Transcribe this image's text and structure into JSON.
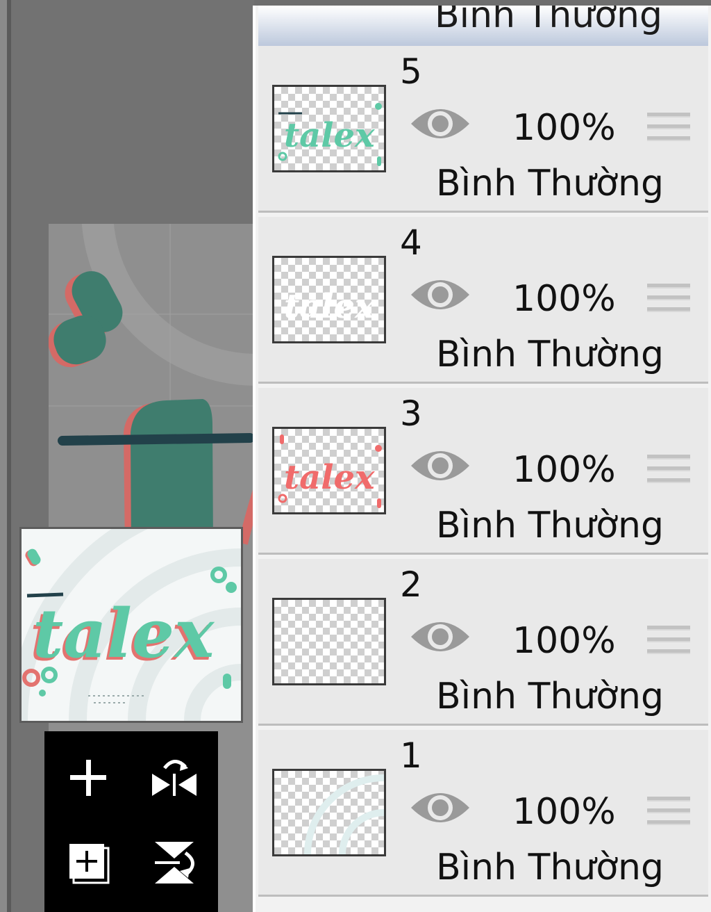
{
  "panel_top": {
    "blend_partial": "Bình Thường"
  },
  "layers": [
    {
      "number": "5",
      "opacity": "100%",
      "blend": "Bình Thường",
      "thumb_text": "talex",
      "thumb_color": "#5ec9a6"
    },
    {
      "number": "4",
      "opacity": "100%",
      "blend": "Bình Thường",
      "thumb_text": "talex",
      "thumb_color": "#ffffff"
    },
    {
      "number": "3",
      "opacity": "100%",
      "blend": "Bình Thường",
      "thumb_text": "talex",
      "thumb_color": "#f06b6b"
    },
    {
      "number": "2",
      "opacity": "100%",
      "blend": "Bình Thường",
      "thumb_text": "",
      "thumb_color": ""
    },
    {
      "number": "1",
      "opacity": "100%",
      "blend": "Bình Thường",
      "thumb_text": "",
      "thumb_color": ""
    }
  ],
  "preview": {
    "title": "talex",
    "accent": "#5ec9a6",
    "shadow": "#e3736f"
  },
  "tools": {
    "add_layer_icon": "plus-icon",
    "flip_horizontal_icon": "flip-horizontal-icon",
    "add_copy_icon": "add-copy-icon",
    "flip_vertical_icon": "flip-vertical-icon"
  },
  "colors": {
    "panel_bg": "#e9e9e9",
    "eye": "#9a9a9a",
    "canvas_bg": "#727272",
    "teal": "#3f7d6e",
    "coral": "#d46a66"
  }
}
